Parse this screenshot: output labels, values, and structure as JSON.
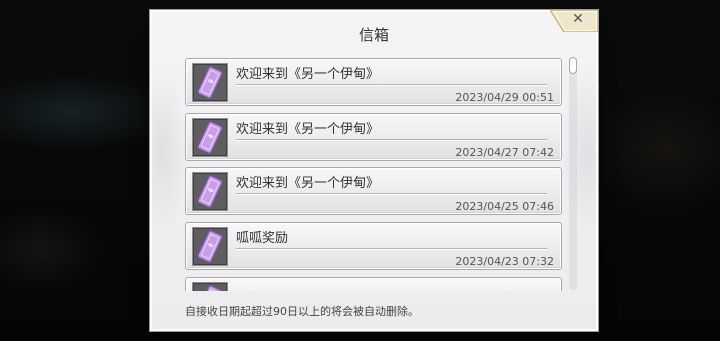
{
  "window": {
    "title": "信箱"
  },
  "close_button": {
    "icon": "close-icon",
    "glyph": "✕"
  },
  "mails": [
    {
      "title": "欢迎来到《另一个伊甸》",
      "date": "2023/04/29 00:51",
      "icon": "ticket-icon"
    },
    {
      "title": "欢迎来到《另一个伊甸》",
      "date": "2023/04/27 07:42",
      "icon": "ticket-icon"
    },
    {
      "title": "欢迎来到《另一个伊甸》",
      "date": "2023/04/25 07:46",
      "icon": "ticket-icon"
    },
    {
      "title": "呱呱奖励",
      "date": "2023/04/23 07:32",
      "icon": "ticket-icon"
    },
    {
      "icon": "ticket-icon"
    }
  ],
  "scroll_position": 0,
  "footer": {
    "note": "自接收日期起超过90日以上的将会被自动删除。"
  },
  "colors": {
    "backdrop": "#0b0b0b",
    "dialog": "#ececee",
    "text": "#333333",
    "ticket": "#c89ee9",
    "ticket_edge": "#8a58c2",
    "close_tab": "#efe6cb",
    "close_tab_edge": "#c5ad74"
  }
}
